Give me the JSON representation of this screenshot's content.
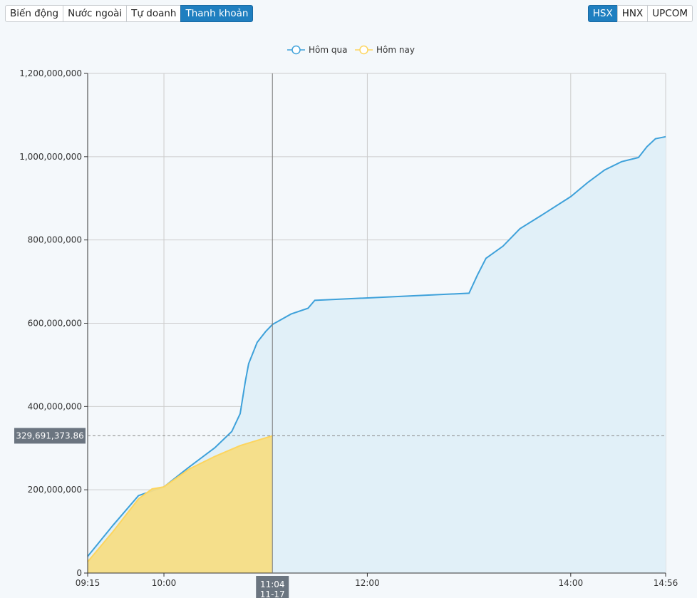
{
  "tabs": [
    {
      "label": "Biến động",
      "active": false
    },
    {
      "label": "Nước ngoài",
      "active": false
    },
    {
      "label": "Tự doanh",
      "active": false
    },
    {
      "label": "Thanh khoản",
      "active": true
    }
  ],
  "exchanges": [
    {
      "label": "HSX",
      "active": true
    },
    {
      "label": "HNX",
      "active": false
    },
    {
      "label": "UPCOM",
      "active": false
    }
  ],
  "chart_data": {
    "type": "area",
    "x_ticks": [
      "09:15",
      "10:00",
      "12:00",
      "14:00",
      "14:56"
    ],
    "y_ticks": [
      "0",
      "200,000,000",
      "400,000,000",
      "600,000,000",
      "800,000,000",
      "1,000,000,000",
      "1,200,000,000"
    ],
    "ylim": [
      0,
      1200000000
    ],
    "xlim": [
      "09:15",
      "14:56"
    ],
    "legend": "top-center",
    "crosshair": {
      "x_label": "11:04",
      "date_label": "11-17",
      "y_label": "329,691,373.86",
      "y_value": 329691373.86,
      "x": "11:04"
    },
    "series": [
      {
        "name": "Hôm qua",
        "color": "#3ea1da",
        "fill": "#e1f0f8",
        "points": [
          [
            "09:15",
            40
          ],
          [
            "09:30",
            115
          ],
          [
            "09:45",
            186
          ],
          [
            "10:00",
            207
          ],
          [
            "10:15",
            255
          ],
          [
            "10:30",
            301
          ],
          [
            "10:40",
            340
          ],
          [
            "10:45",
            383
          ],
          [
            "10:48",
            460
          ],
          [
            "10:50",
            503
          ],
          [
            "10:55",
            554
          ],
          [
            "11:00",
            580
          ],
          [
            "11:04",
            597
          ],
          [
            "11:15",
            622
          ],
          [
            "11:25",
            636
          ],
          [
            "11:29",
            655
          ],
          [
            "13:00",
            672
          ],
          [
            "13:05",
            716
          ],
          [
            "13:10",
            756
          ],
          [
            "13:20",
            785
          ],
          [
            "13:30",
            827
          ],
          [
            "13:45",
            865
          ],
          [
            "14:00",
            904
          ],
          [
            "14:10",
            938
          ],
          [
            "14:20",
            968
          ],
          [
            "14:30",
            988
          ],
          [
            "14:40",
            998
          ],
          [
            "14:45",
            1024
          ],
          [
            "14:50",
            1043
          ],
          [
            "14:56",
            1048
          ]
        ]
      },
      {
        "name": "Hôm nay",
        "color": "#fdd55e",
        "fill": "#f5dd85",
        "points": [
          [
            "09:15",
            27
          ],
          [
            "09:30",
            100
          ],
          [
            "09:45",
            178
          ],
          [
            "09:53",
            202
          ],
          [
            "10:00",
            207
          ],
          [
            "10:15",
            250
          ],
          [
            "10:30",
            280
          ],
          [
            "10:45",
            306
          ],
          [
            "11:04",
            329.69
          ]
        ]
      }
    ],
    "value_unit_multiplier": 1000000
  }
}
